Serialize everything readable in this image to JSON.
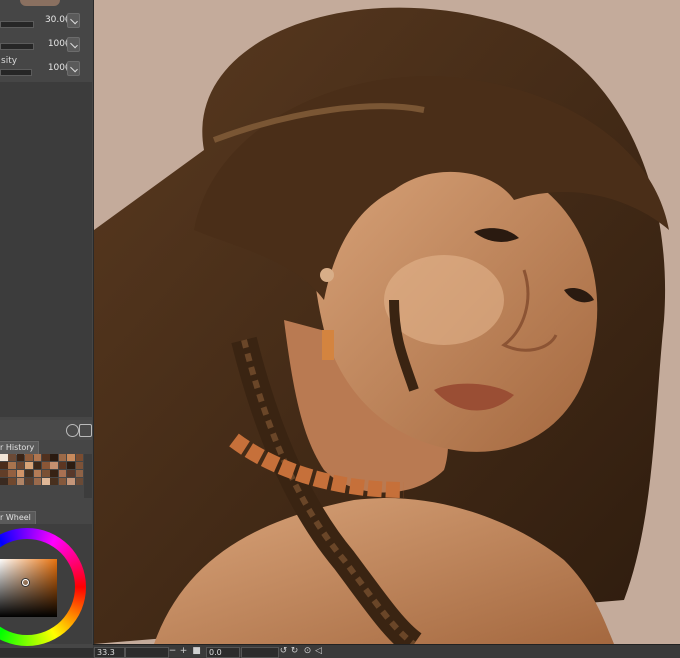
{
  "tool_properties": {
    "rows": [
      {
        "label": "",
        "value": "30.0"
      },
      {
        "label": "",
        "value": "100"
      },
      {
        "label": "sity",
        "value": "100"
      }
    ]
  },
  "color_history": {
    "tab_label": "r History",
    "swatches": [
      "#f1e4d6",
      "#6b4a36",
      "#3a2416",
      "#8c5a3a",
      "#b07650",
      "#50311f",
      "#2a1a10",
      "#9c6a48",
      "#c88a5c",
      "#7a4c30",
      "#5a3a26",
      "#4a2c1a",
      "#a8744e",
      "#6e4832",
      "#d8a478",
      "#3e2818",
      "#8a5636",
      "#c49070",
      "#5c3622",
      "#2c1c12",
      "#7c5238",
      "#b88058",
      "#623e28",
      "#946040",
      "#d09468",
      "#443020",
      "#b47c56",
      "#7a5034",
      "#362214",
      "#a87052",
      "#58382a",
      "#8e6246",
      "#caa080",
      "#3a2a20",
      "#70482e",
      "#b08466",
      "#5a4030",
      "#9a6a4c",
      "#e0b898",
      "#48301e",
      "#84583c",
      "#c4967a",
      "#6a4a36",
      "#a0785c"
    ]
  },
  "color_wheel": {
    "tab_label": "r Wheel",
    "selected_color": "#e8720e"
  },
  "mini_status": {
    "text": "..."
  },
  "status_bar": {
    "zoom": "33.3",
    "angle": "0.0"
  },
  "canvas": {
    "background": "#c4ab9b",
    "subject": "portrait painting"
  },
  "icons": [
    "pen-pressure-icon",
    "reset-icon",
    "settings-icon",
    "zoom-in-icon",
    "zoom-out-icon",
    "rotate-left-icon",
    "rotate-right-icon",
    "flip-icon"
  ]
}
